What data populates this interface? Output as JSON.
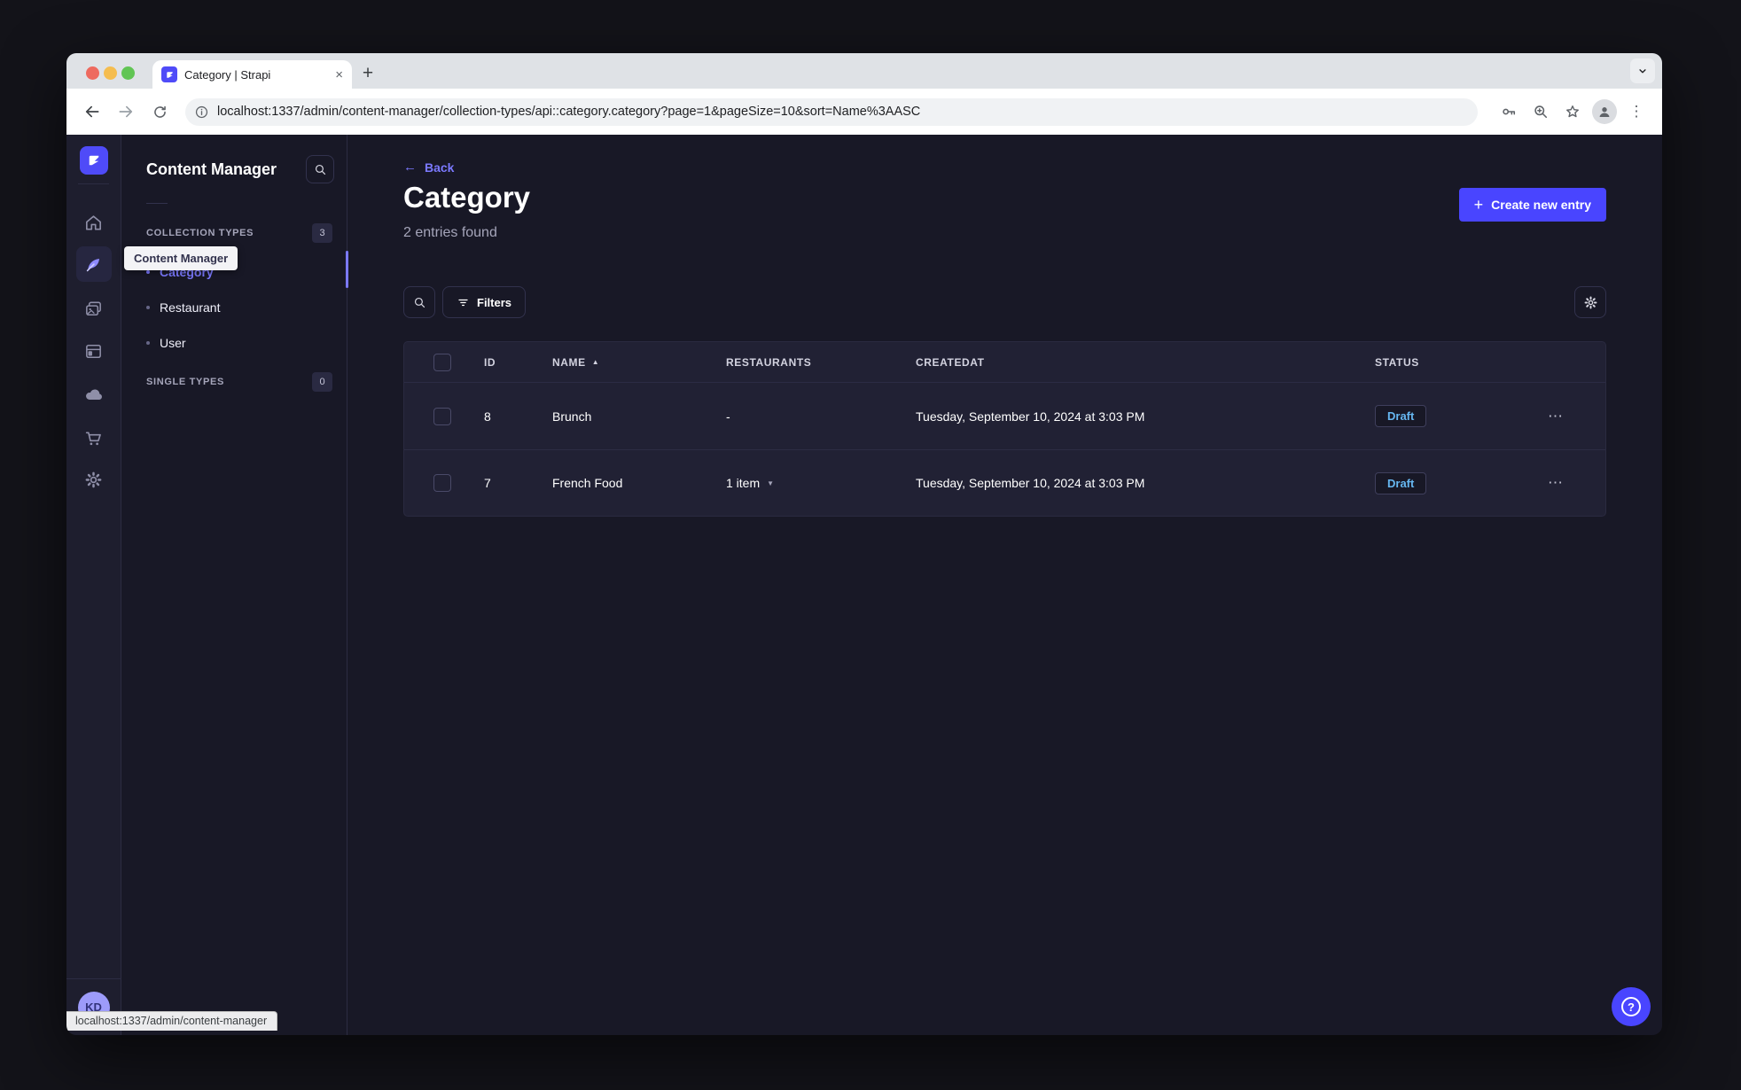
{
  "browser": {
    "tab_title": "Category | Strapi",
    "new_tab_label": "+",
    "close_tab_label": "×",
    "url": "localhost:1337/admin/content-manager/collection-types/api::category.category?page=1&pageSize=10&sort=Name%3AASC",
    "status_bar": "localhost:1337/admin/content-manager"
  },
  "nav": {
    "tooltip": "Content Manager",
    "avatar_initials": "KD",
    "icons": [
      "strapi-logo",
      "home",
      "content-manager",
      "media-library",
      "content-type-builder",
      "cloud",
      "marketplace",
      "settings"
    ]
  },
  "subnav": {
    "title": "Content Manager",
    "collection_types": {
      "label": "COLLECTION TYPES",
      "count": "3",
      "items": [
        {
          "label": "Category",
          "active": true
        },
        {
          "label": "Restaurant",
          "active": false
        },
        {
          "label": "User",
          "active": false
        }
      ]
    },
    "single_types": {
      "label": "SINGLE TYPES",
      "count": "0"
    }
  },
  "main": {
    "back": "Back",
    "title": "Category",
    "subtitle": "2 entries found",
    "create_button": "Create new entry",
    "filters": "Filters",
    "table": {
      "headers": {
        "id": "ID",
        "name": "NAME",
        "restaurants": "RESTAURANTS",
        "createdat": "CREATEDAT",
        "status": "STATUS"
      },
      "rows": [
        {
          "id": "8",
          "name": "Brunch",
          "restaurants": "-",
          "createdat": "Tuesday, September 10, 2024 at 3:03 PM",
          "status": "Draft"
        },
        {
          "id": "7",
          "name": "French Food",
          "restaurants": "1 item",
          "createdat": "Tuesday, September 10, 2024 at 3:03 PM",
          "status": "Draft"
        }
      ]
    }
  },
  "colors": {
    "primary": "#4945ff",
    "link": "#7b79ff",
    "draft_text": "#66b7f1"
  }
}
